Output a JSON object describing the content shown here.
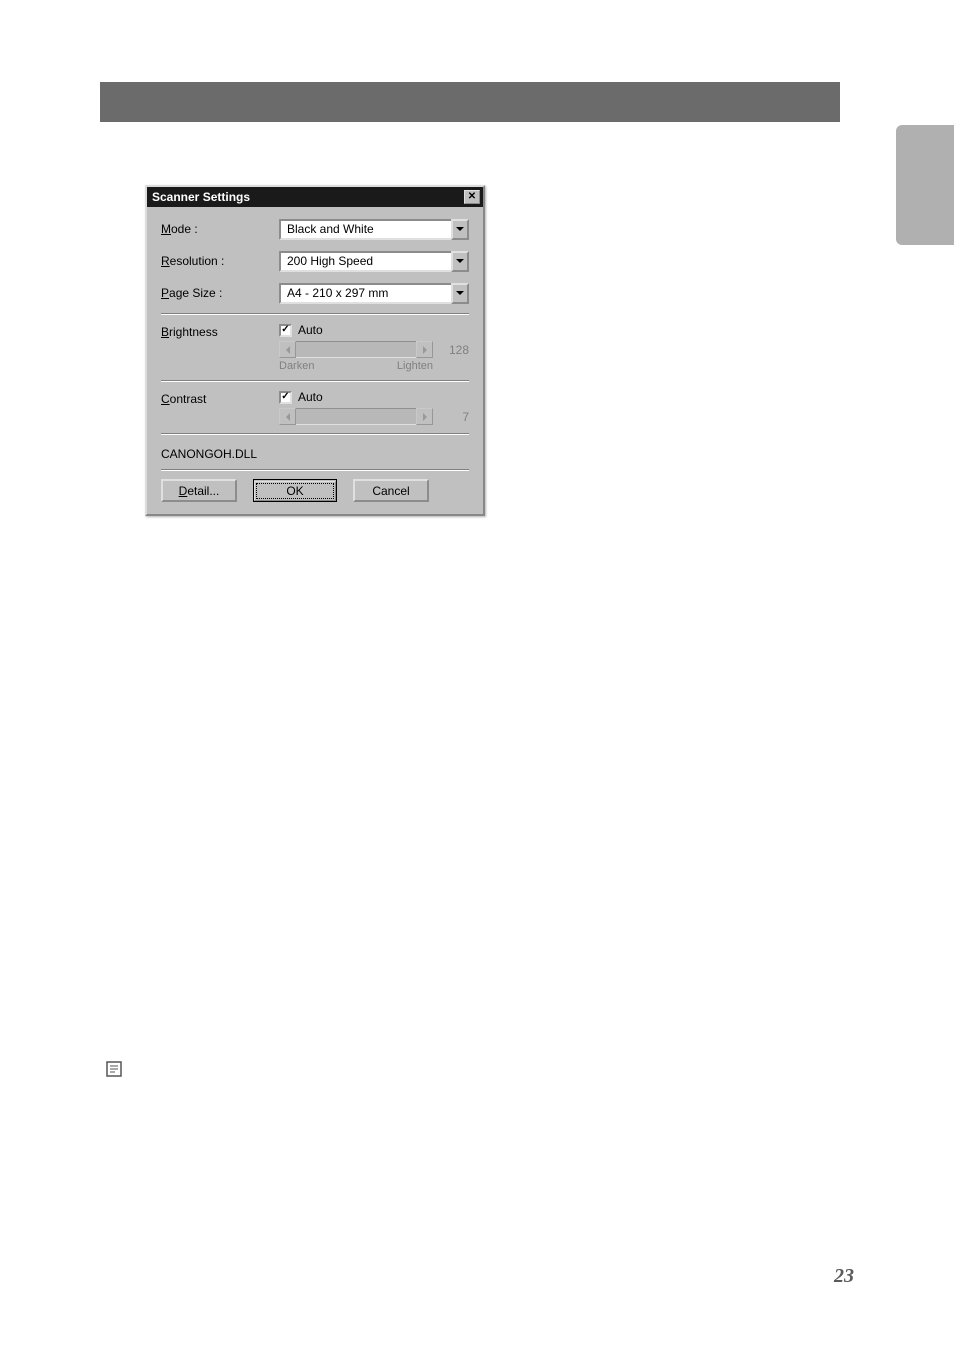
{
  "dialog": {
    "title": "Scanner Settings",
    "mode_label_pre": "M",
    "mode_label_rest": "ode :",
    "mode_value": "Black and White",
    "resolution_label_pre": "R",
    "resolution_label_rest": "esolution :",
    "resolution_value": "200 High Speed",
    "pagesize_label_pre": "P",
    "pagesize_label_rest": "age Size :",
    "pagesize_value": "A4 - 210 x 297 mm",
    "brightness_label_pre": "B",
    "brightness_label_rest": "rightness",
    "brightness_auto": "Auto",
    "brightness_value": "128",
    "brightness_darken": "Darken",
    "brightness_lighten": "Lighten",
    "contrast_label_pre": "C",
    "contrast_label_rest": "ontrast",
    "contrast_auto": "Auto",
    "contrast_value": "7",
    "dll_name": "CANONGOH.DLL",
    "detail_label_pre": "D",
    "detail_label_rest": "etail...",
    "ok_label": "OK",
    "cancel_label": "Cancel"
  },
  "page_number": "23"
}
